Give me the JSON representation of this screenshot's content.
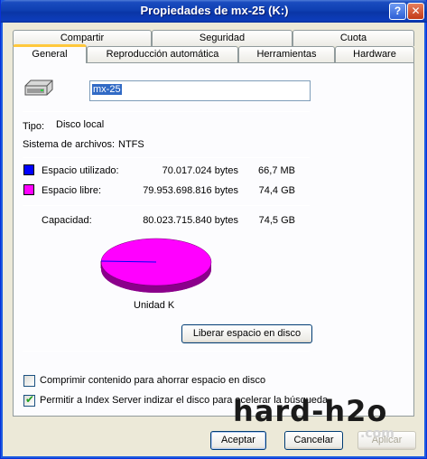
{
  "window": {
    "title": "Propiedades de mx-25 (K:)"
  },
  "tabs_row1": [
    "Compartir",
    "Seguridad",
    "Cuota"
  ],
  "tabs_row2": [
    "General",
    "Reproducción automática",
    "Herramientas",
    "Hardware"
  ],
  "drive_name": "mx-25",
  "tipo_label": "Tipo:",
  "tipo_value": "Disco local",
  "fs_label": "Sistema de archivos:",
  "fs_value": "NTFS",
  "used": {
    "label": "Espacio utilizado:",
    "bytes": "70.017.024 bytes",
    "size": "66,7 MB",
    "color": "#0000ff"
  },
  "free": {
    "label": "Espacio libre:",
    "bytes": "79.953.698.816 bytes",
    "size": "74,4 GB",
    "color": "#ff00ff"
  },
  "capacity": {
    "label": "Capacidad:",
    "bytes": "80.023.715.840 bytes",
    "size": "74,5 GB"
  },
  "drive_label": "Unidad K",
  "cleanup_button": "Liberar espacio en disco",
  "compress_checkbox": {
    "label": "Comprimir contenido para ahorrar espacio en disco",
    "checked": false
  },
  "index_checkbox": {
    "label": "Permitir a Index Server indizar el disco para acelerar la búsqueda",
    "checked": true
  },
  "buttons": {
    "ok": "Aceptar",
    "cancel": "Cancelar",
    "apply": "Aplicar"
  },
  "watermark": {
    "main": "hard-h2o",
    "sub": ".com"
  }
}
